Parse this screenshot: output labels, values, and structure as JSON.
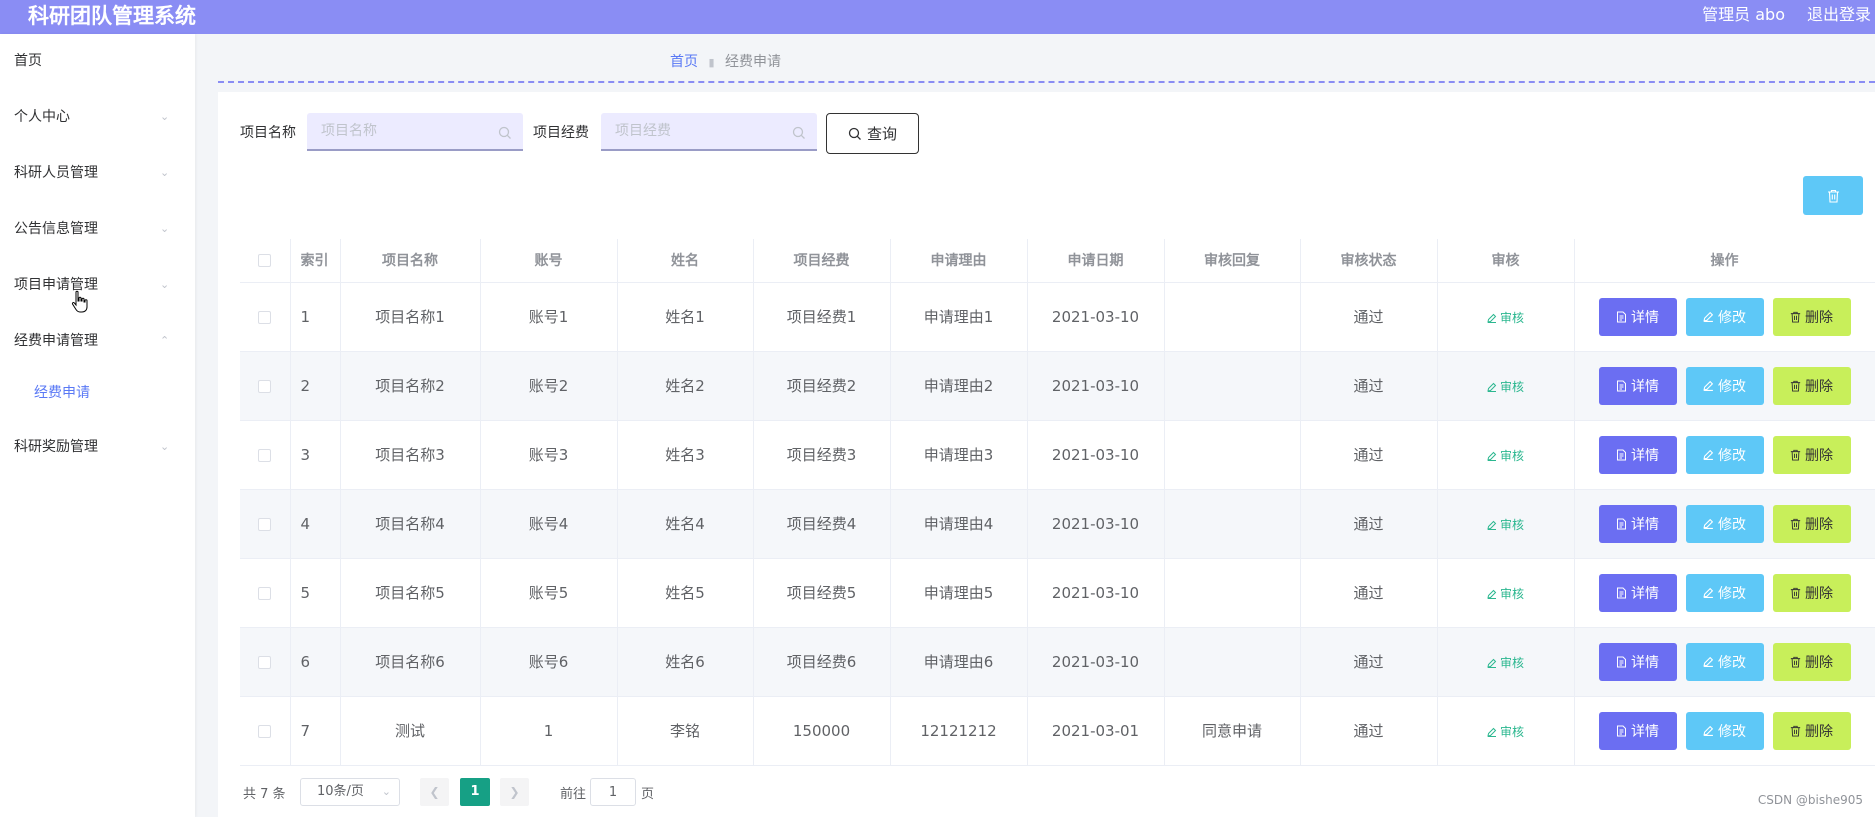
{
  "header": {
    "app_title": "科研团队管理系统",
    "user_label": "管理员 abo",
    "logout_label": "退出登录"
  },
  "sidebar": {
    "items": [
      {
        "label": "首页",
        "expandable": false
      },
      {
        "label": "个人中心",
        "expandable": true
      },
      {
        "label": "科研人员管理",
        "expandable": true
      },
      {
        "label": "公告信息管理",
        "expandable": true
      },
      {
        "label": "项目申请管理",
        "expandable": true
      },
      {
        "label": "经费申请管理",
        "expandable": true,
        "expanded": true
      },
      {
        "label": "科研奖励管理",
        "expandable": true
      }
    ],
    "active_subitem": "经费申请"
  },
  "breadcrumb": {
    "home": "首页",
    "current": "经费申请"
  },
  "search": {
    "name_label": "项目名称",
    "name_placeholder": "项目名称",
    "funds_label": "项目经费",
    "funds_placeholder": "项目经费",
    "query_label": "查询"
  },
  "table": {
    "columns": [
      "索引",
      "项目名称",
      "账号",
      "姓名",
      "项目经费",
      "申请理由",
      "申请日期",
      "审核回复",
      "审核状态",
      "审核",
      "操作"
    ],
    "audit_link_label": "审核",
    "actions": {
      "detail": "详情",
      "edit": "修改",
      "delete": "删除"
    },
    "rows": [
      {
        "index": "1",
        "project": "项目名称1",
        "account": "账号1",
        "name": "姓名1",
        "funds": "项目经费1",
        "reason": "申请理由1",
        "date": "2021-03-10",
        "reply": "",
        "status": "通过"
      },
      {
        "index": "2",
        "project": "项目名称2",
        "account": "账号2",
        "name": "姓名2",
        "funds": "项目经费2",
        "reason": "申请理由2",
        "date": "2021-03-10",
        "reply": "",
        "status": "通过"
      },
      {
        "index": "3",
        "project": "项目名称3",
        "account": "账号3",
        "name": "姓名3",
        "funds": "项目经费3",
        "reason": "申请理由3",
        "date": "2021-03-10",
        "reply": "",
        "status": "通过"
      },
      {
        "index": "4",
        "project": "项目名称4",
        "account": "账号4",
        "name": "姓名4",
        "funds": "项目经费4",
        "reason": "申请理由4",
        "date": "2021-03-10",
        "reply": "",
        "status": "通过"
      },
      {
        "index": "5",
        "project": "项目名称5",
        "account": "账号5",
        "name": "姓名5",
        "funds": "项目经费5",
        "reason": "申请理由5",
        "date": "2021-03-10",
        "reply": "",
        "status": "通过"
      },
      {
        "index": "6",
        "project": "项目名称6",
        "account": "账号6",
        "name": "姓名6",
        "funds": "项目经费6",
        "reason": "申请理由6",
        "date": "2021-03-10",
        "reply": "",
        "status": "通过"
      },
      {
        "index": "7",
        "project": "测试",
        "account": "1",
        "name": "李铭",
        "funds": "150000",
        "reason": "12121212",
        "date": "2021-03-01",
        "reply": "同意申请",
        "status": "通过"
      }
    ]
  },
  "pagination": {
    "total_text": "共 7 条",
    "page_size": "10条/页",
    "current_page": "1",
    "goto_label": "前往",
    "goto_value": "1",
    "page_suffix": "页"
  },
  "watermark": "CSDN @bishe905",
  "colors": {
    "header_bg": "#8a8df4",
    "detail_btn": "#6b6ef2",
    "edit_btn": "#5ec8f7",
    "delete_btn": "#c8ef5a",
    "audit_link": "#2bb78f",
    "active_page": "#16a085"
  }
}
